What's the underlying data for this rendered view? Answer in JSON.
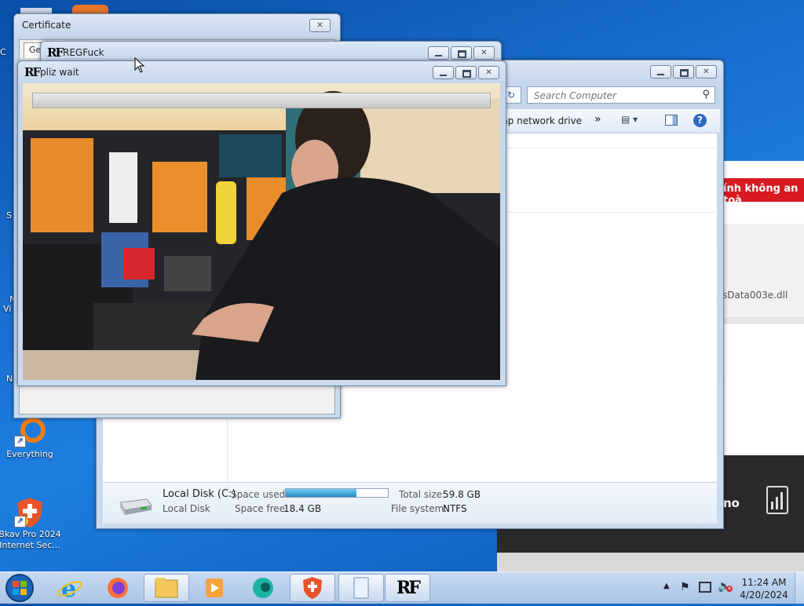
{
  "desktop": {
    "icons": [
      {
        "label": "Everything",
        "icon": "everything-icon"
      },
      {
        "label": "Bkav Pro 2024",
        "label2": "Internet Sec...",
        "icon": "bkav-icon"
      }
    ],
    "edge_fragments": [
      "C",
      "S",
      "N",
      "Vi",
      "N"
    ]
  },
  "certificate_window": {
    "title": "Certificate",
    "tab_label": "Ge"
  },
  "regfuck_window": {
    "title": "REGFuck",
    "logo": "RF"
  },
  "pliz_window": {
    "title": "pliz wait",
    "logo": "RF",
    "progress": 0.0
  },
  "explorer_window": {
    "search_placeholder": "Search Computer",
    "toolbar_map_drive": "Map network drive",
    "toolbar_more": "»",
    "drive": {
      "name": "Local Disk (C:)",
      "type": "Local Disk",
      "space_used_label": "Space used:",
      "space_free_label": "Space free:",
      "space_free_value": "18.4 GB",
      "total_size_label": "Total size:",
      "total_size_value": "59.8 GB",
      "file_system_label": "File system:",
      "file_system_value": "NTFS",
      "used_fraction": 0.69
    }
  },
  "bkav_bg_window": {
    "alert_text": "ính không an toà",
    "file_text": "sData003e.dll",
    "bottom_text": "no"
  },
  "taskbar": {
    "items": [
      "start-orb",
      "internet-explorer",
      "firefox",
      "file-explorer",
      "media-player",
      "app-teal",
      "bkav",
      "notepad",
      "regfuck"
    ],
    "clock_time": "11:24 AM",
    "clock_date": "4/20/2024"
  },
  "colors": {
    "accent_blue": "#1d7fe0",
    "alert_red": "#d71920",
    "progress_fill": "#1f8ec9"
  }
}
